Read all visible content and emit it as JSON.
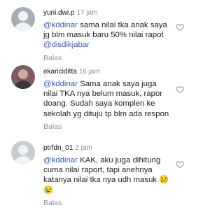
{
  "comments": [
    {
      "username": "yuni.dwi.p",
      "time": "17 jam",
      "mention": "@kddinar",
      "text_1": " sama nilai tka anak saya jg blm masuk baru 50% nilai rapot ",
      "mention_2": "@disdikjabar",
      "reply": "Balas"
    },
    {
      "username": "ekariciditta",
      "time": "16 jam",
      "mention": "@kddinar",
      "text_1": " Sama anak saya juga nilai TKA nya belum masuk, rapor doang. Sudah saya komplen ke sekolah yg dituju tp blm ada respon",
      "reply": "Balas"
    },
    {
      "username": "ptrfdn_01",
      "time": "2 jam",
      "mention": "@kddinar",
      "text_1": " KAK, aku juga dihitung cuma nilai raport, tapi anehnya katanya nilai tka nya udh masuk 😢😢",
      "reply": "Balas"
    }
  ],
  "icons": {
    "avatar": "default-user-avatar",
    "like": "heart-outline-icon"
  }
}
